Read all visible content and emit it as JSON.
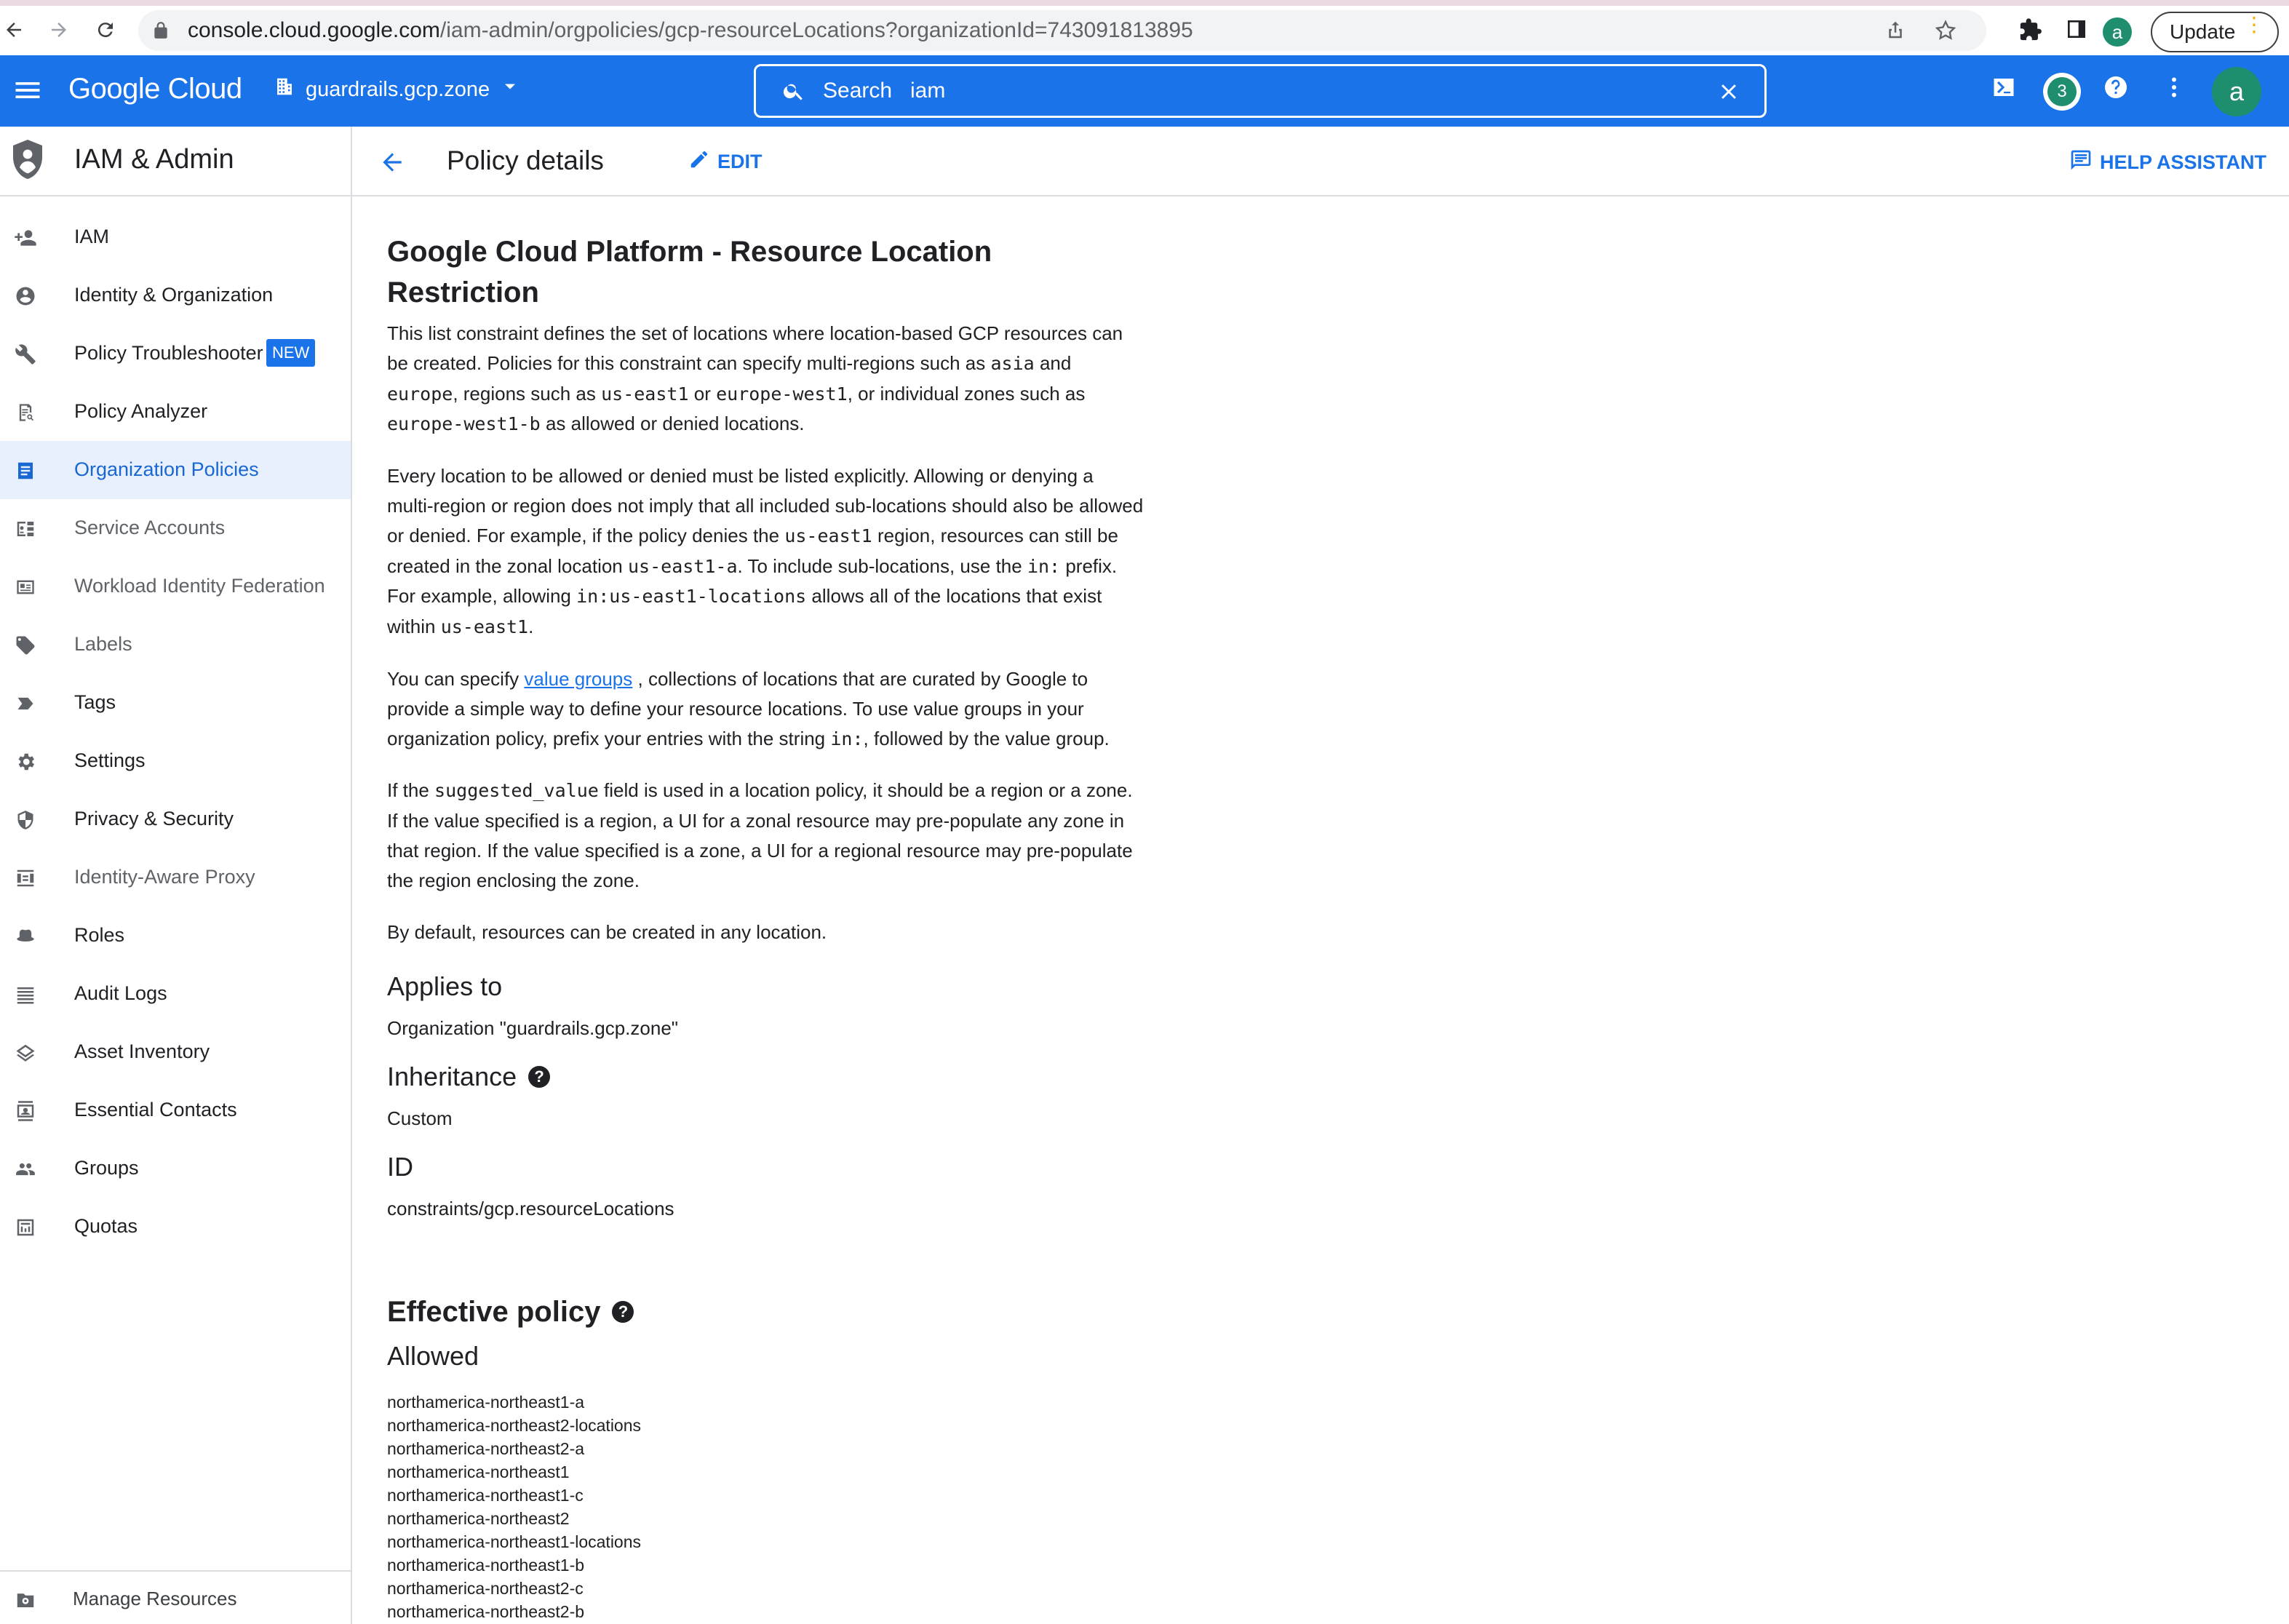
{
  "browser": {
    "url_host": "console.cloud.google.com",
    "url_path": "/iam-admin/orgpolicies/gcp-resourceLocations?organizationId=743091813895",
    "profile_initial": "a",
    "update_label": "Update",
    "update_dots": "⋮"
  },
  "topbar": {
    "logo_text": "Google Cloud",
    "project_name": "guardrails.gcp.zone",
    "search_label": "Search",
    "search_value": "iam",
    "notification_count": "3",
    "avatar_initial": "a",
    "brand_color": "#1a73e8"
  },
  "sidebar": {
    "title": "IAM & Admin",
    "items": [
      {
        "label": "IAM",
        "icon": "person-add-icon"
      },
      {
        "label": "Identity & Organization",
        "icon": "account-circle-icon"
      },
      {
        "label": "Policy Troubleshooter",
        "icon": "wrench-icon",
        "badge": "NEW"
      },
      {
        "label": "Policy Analyzer",
        "icon": "policy-analyzer-icon"
      },
      {
        "label": "Organization Policies",
        "icon": "document-icon",
        "active": true
      },
      {
        "label": "Service Accounts",
        "icon": "service-account-icon"
      },
      {
        "label": "Workload Identity Federation",
        "icon": "id-card-icon"
      },
      {
        "label": "Labels",
        "icon": "label-icon"
      },
      {
        "label": "Tags",
        "icon": "tag-icon"
      },
      {
        "label": "Settings",
        "icon": "gear-icon"
      },
      {
        "label": "Privacy & Security",
        "icon": "shield-icon"
      },
      {
        "label": "Identity-Aware Proxy",
        "icon": "proxy-icon"
      },
      {
        "label": "Roles",
        "icon": "hat-icon"
      },
      {
        "label": "Audit Logs",
        "icon": "list-icon"
      },
      {
        "label": "Asset Inventory",
        "icon": "layers-icon"
      },
      {
        "label": "Essential Contacts",
        "icon": "contacts-icon"
      },
      {
        "label": "Groups",
        "icon": "group-icon"
      },
      {
        "label": "Quotas",
        "icon": "quota-icon"
      }
    ],
    "footer_label": "Manage Resources"
  },
  "header": {
    "title": "Policy details",
    "edit_label": "EDIT",
    "help_label": "HELP ASSISTANT"
  },
  "policy": {
    "title": "Google Cloud Platform - Resource Location Restriction",
    "p1": {
      "a": "This list constraint defines the set of locations where location-based GCP resources can be created. Policies for this constraint can specify multi-regions such as ",
      "c1": "asia",
      "b": " and ",
      "c2": "europe",
      "c": ", regions such as ",
      "c3": "us-east1",
      "d": " or ",
      "c4": "europe-west1",
      "e": ", or individual zones such as ",
      "c5": "europe-west1-b",
      "f": " as allowed or denied locations."
    },
    "p2": {
      "a": "Every location to be allowed or denied must be listed explicitly. Allowing or denying a multi-region or region does not imply that all included sub-locations should also be allowed or denied. For example, if the policy denies the ",
      "c1": "us-east1",
      "b": " region, resources can still be created in the zonal location ",
      "c2": "us-east1-a",
      "c": ". To include sub-locations, use the ",
      "c3": "in:",
      "d": " prefix. For example, allowing ",
      "c4": "in:us-east1-locations",
      "e": " allows all of the locations that exist within ",
      "c5": "us-east1",
      "f": "."
    },
    "p3": {
      "a": "You can specify ",
      "link": "value groups",
      "b": " , collections of locations that are curated by Google to provide a simple way to define your resource locations. To use value groups in your organization policy, prefix your entries with the string ",
      "c1": "in:",
      "c": ", followed by the value group."
    },
    "p4": {
      "a": "If the ",
      "c1": "suggested_value",
      "b": " field is used in a location policy, it should be a region or a zone. If the value specified is a region, a UI for a zonal resource may pre-populate any zone in that region. If the value specified is a zone, a UI for a regional resource may pre-populate the region enclosing the zone."
    },
    "p5": "By default, resources can be created in any location.",
    "applies_to_heading": "Applies to",
    "applies_to_value": "Organization \"guardrails.gcp.zone\"",
    "inheritance_heading": "Inheritance",
    "inheritance_value": "Custom",
    "id_heading": "ID",
    "id_value": "constraints/gcp.resourceLocations",
    "effective_heading": "Effective policy",
    "allowed_heading": "Allowed",
    "allowed": [
      "northamerica-northeast1-a",
      "northamerica-northeast2-locations",
      "northamerica-northeast2-a",
      "northamerica-northeast1",
      "northamerica-northeast1-c",
      "northamerica-northeast2",
      "northamerica-northeast1-locations",
      "northamerica-northeast1-b",
      "northamerica-northeast2-c",
      "northamerica-northeast2-b"
    ]
  }
}
